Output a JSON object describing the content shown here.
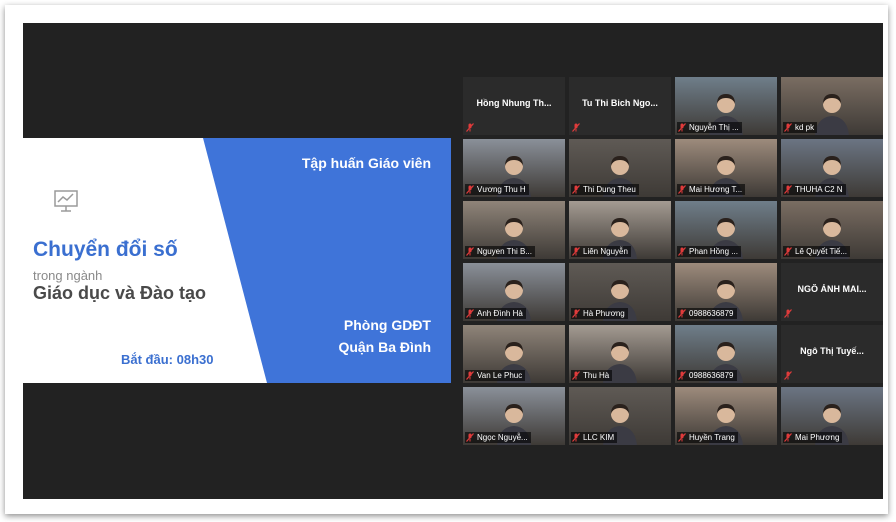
{
  "slide": {
    "training_title": "Tập huấn Giáo viên",
    "heading_main": "Chuyển đổi số",
    "heading_sub": "trong ngành",
    "heading_field": "Giáo dục và Đào tạo",
    "department_line1": "Phòng GDĐT",
    "department_line2": "Quận Ba Đình",
    "start_time": "Bắt đầu: 08h30",
    "accent_color": "#3f74d9",
    "presentation_icon": "presentation-chart-icon"
  },
  "participants": [
    {
      "name": "Hồng Nhung Th...",
      "video": false
    },
    {
      "name": "Tu Thi Bich Ngo...",
      "video": false
    },
    {
      "name": "Nguyễn Thị ...",
      "video": true
    },
    {
      "name": "kd pk",
      "video": true
    },
    {
      "name": "Vương Thu H",
      "video": true
    },
    {
      "name": "Thi Dung Theu",
      "video": true
    },
    {
      "name": "Mai Hương T...",
      "video": true
    },
    {
      "name": "THUHA C2 N",
      "video": true
    },
    {
      "name": "Nguyen Thi B...",
      "video": true
    },
    {
      "name": "Liên Nguyễn",
      "video": true
    },
    {
      "name": "Phan Hồng ...",
      "video": true
    },
    {
      "name": "Lê Quyết Tiế...",
      "video": true
    },
    {
      "name": "Anh Đình Hà",
      "video": true
    },
    {
      "name": "Hà Phương",
      "video": true
    },
    {
      "name": "0988636879",
      "video": true
    },
    {
      "name": "NGÔ ÁNH MAI...",
      "video": false
    },
    {
      "name": "Van Le Phuc",
      "video": true
    },
    {
      "name": "Thu Hà",
      "video": true
    },
    {
      "name": "0988636879",
      "video": true
    },
    {
      "name": "Ngô Thị Tuyế...",
      "video": false
    },
    {
      "name": "Ngọc Nguyễ...",
      "video": true
    },
    {
      "name": "LLC KIM",
      "video": true
    },
    {
      "name": "Huyền Trang",
      "video": true
    },
    {
      "name": "Mai Phương",
      "video": true
    }
  ],
  "muted_icon": "microphone-muted-icon"
}
